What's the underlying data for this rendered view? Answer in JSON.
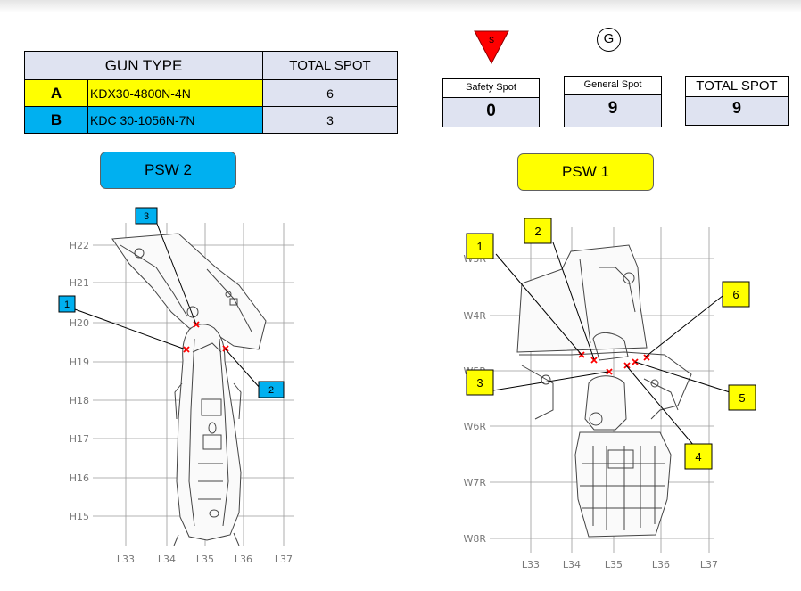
{
  "gun_table": {
    "header_gun_type": "GUN TYPE",
    "header_total_spot": "TOTAL SPOT",
    "rows": [
      {
        "letter": "A",
        "gun": "KDX30-4800N-4N",
        "count": "6",
        "color": "#ffff00"
      },
      {
        "letter": "B",
        "gun": "KDC 30-1056N-7N",
        "count": "3",
        "color": "#00b0f0"
      }
    ]
  },
  "symbols": {
    "safety_letter": "S",
    "general_letter": "G",
    "safety_color": "#ff0000"
  },
  "spot_summary": {
    "safety_label": "Safety Spot",
    "safety_value": "0",
    "general_label": "General Spot",
    "general_value": "9",
    "total_label": "TOTAL SPOT",
    "total_value": "9"
  },
  "psw2": {
    "title": "PSW 2",
    "color": "#00b0f0",
    "row_labels": [
      "H22",
      "H21",
      "H20",
      "H19",
      "H18",
      "H17",
      "H16",
      "H15"
    ],
    "col_labels": [
      "L33",
      "L34",
      "L35",
      "L36",
      "L37"
    ],
    "spots": [
      "1",
      "2",
      "3"
    ]
  },
  "psw1": {
    "title": "PSW 1",
    "color": "#ffff00",
    "row_labels": [
      "W3R",
      "W4R",
      "W5R",
      "W6R",
      "W7R",
      "W8R"
    ],
    "col_labels": [
      "L33",
      "L34",
      "L35",
      "L36",
      "L37"
    ],
    "spots": [
      "1",
      "2",
      "3",
      "4",
      "5",
      "6"
    ]
  },
  "colors": {
    "weld_mark": "#ff0000",
    "grid": "#9a9a9a",
    "part_line": "#444444"
  }
}
